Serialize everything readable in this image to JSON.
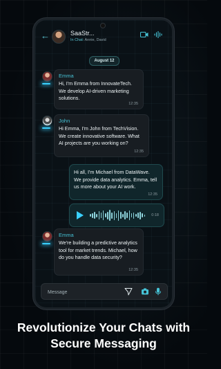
{
  "chat": {
    "title": "SaaStr...",
    "subtitle_label": "In Chat:",
    "subtitle_members": "Annie, David"
  },
  "date_label": "August 12",
  "messages": [
    {
      "sender": "Emma",
      "text": "Hi, I'm Emma from InnovateTech. We develop AI-driven marketing solutions.",
      "time": "12:35"
    },
    {
      "sender": "John",
      "text": "Hi Emma, I'm John from TechVision. We create innovative software. What AI projects are you working on?",
      "time": "12:35"
    },
    {
      "sender": "",
      "text": "Hi all, I'm Michael from DataWave. We provide data analytics. Emma, tell us more about your AI work.",
      "time": "12:35"
    },
    {
      "sender": "Emma",
      "text": "We're building a predictive analytics tool for market trends. Michael, how do you handle data security?",
      "time": "12:35"
    }
  ],
  "voice_message": {
    "duration": "0:18"
  },
  "composer": {
    "placeholder": "Message"
  },
  "icons": {
    "back": "back-arrow-icon",
    "video": "video-call-icon",
    "voice": "voice-wave-icon",
    "send": "send-icon",
    "camera": "camera-icon",
    "mic": "microphone-icon"
  },
  "colors": {
    "accent": "#3ad0ff",
    "name": "#46c3d6"
  },
  "headline": {
    "line1": "Revolutionize Your Chats with",
    "line2": "Secure Messaging"
  }
}
